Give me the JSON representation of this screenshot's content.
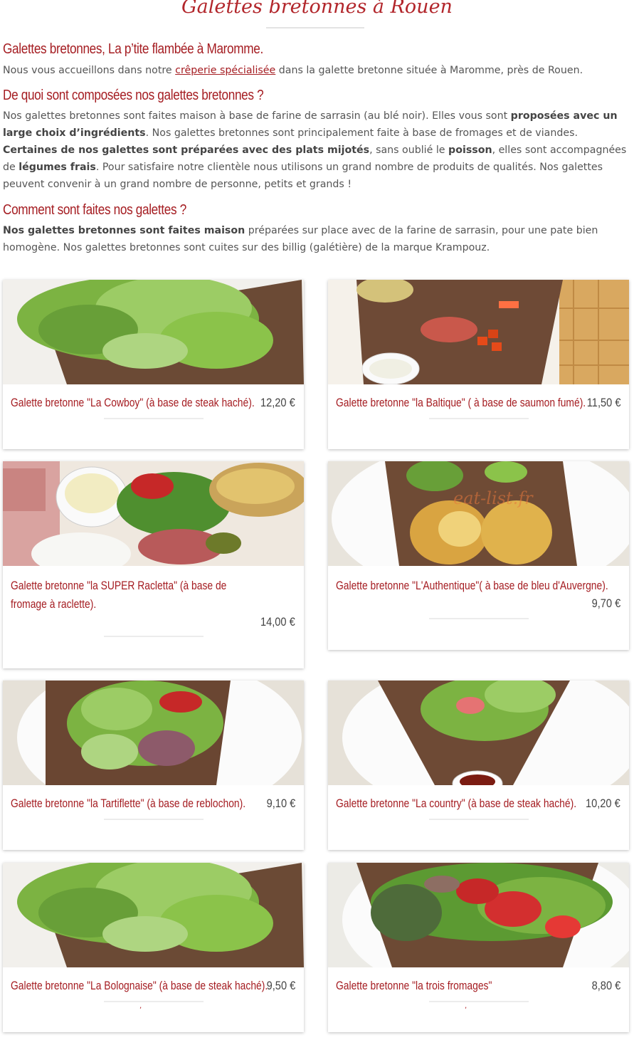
{
  "header": {
    "title": "Galettes bretonnes à Rouen"
  },
  "intro": {
    "heading": "Galettes bretonnes, La p’tite flambée à Maromme.",
    "text_before": "Nous vous accueillons dans notre ",
    "link": "crêperie spécialisée",
    "text_after": " dans la galette bretonne située à Maromme, près de Rouen."
  },
  "composition": {
    "heading": "De quoi sont composées nos galettes bretonnes ?",
    "t1": "Nos galettes bretonnes sont faites maison à base de farine de sarrasin (au blé noir). Elles vous sont ",
    "b1": "proposées avec un large choix d’ingrédients",
    "t2": ". Nos galettes bretonnes sont principalement  faite à base de fromages et de viandes. ",
    "b2": "Certaines de nos  galettes sont préparées avec des plats mijotés",
    "t3": ", sans oublié le ",
    "b3": "poisson",
    "t4": ", elles sont accompagnées de ",
    "b4": "légumes frais",
    "t5": ". Pour satisfaire notre clientèle nous utilisons un grand nombre de produits de qualités. Nos galettes peuvent convenir à un grand nombre de personne, petits et grands !"
  },
  "making": {
    "heading": "Comment sont faites nos galettes ?",
    "b1": "Nos galettes bretonnes sont faites maison",
    "t1": " préparées sur place avec de la farine de sarrasin, pour une pate bien homogène. Nos galettes bretonnes sont cuites sur des billig (galétière) de la marque Krampouz."
  },
  "products": [
    {
      "name": "Galette bretonne \"La Cowboy\" (à base de steak haché).",
      "price": "12,20 €"
    },
    {
      "name": "Galette bretonne \"la Baltique\" ( à base de saumon fumé).",
      "price": "11,50 €"
    },
    {
      "name": "Galette bretonne \"la SUPER Racletta\" (à base de fromage à raclette).",
      "price": "14,00 €"
    },
    {
      "name": "Galette bretonne \"L'Authentique\"( à base de bleu d'Auvergne).",
      "price": "9,70 €",
      "watermark": "eat-list.fr"
    },
    {
      "name": "Galette bretonne \"la Tartiflette\" (à base de reblochon).",
      "price": "9,10 €"
    },
    {
      "name": "Galette bretonne \"La country\" (à base de steak haché).",
      "price": "10,20 €"
    },
    {
      "name": "Galette bretonne \"La Bolognaise\" (à base de steak haché).",
      "price": "9,50 €",
      "mark": ","
    },
    {
      "name": "Galette bretonne \"la trois fromages\"",
      "price": "8,80 €",
      "mark": ","
    }
  ]
}
